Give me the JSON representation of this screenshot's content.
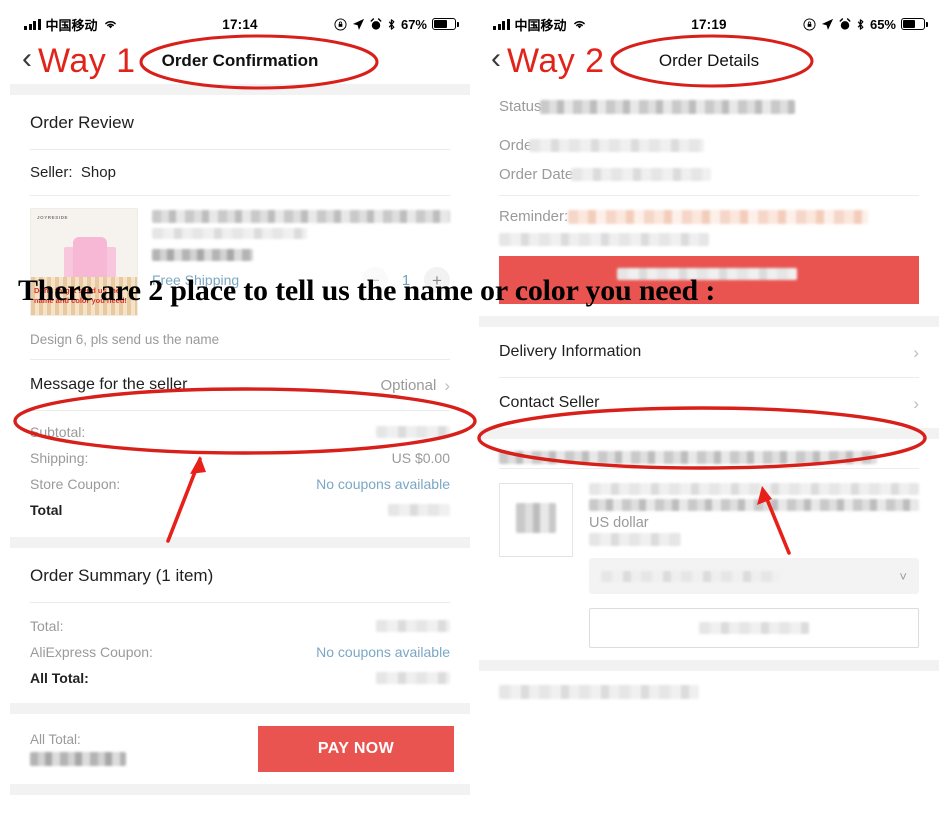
{
  "annotation": {
    "headline": "There are 2 place to tell us the name or color you need :",
    "way1": "Way 1",
    "way2": "Way 2",
    "accent_red": "#e2231a",
    "ellipse_color": "#d81f1a",
    "arrow_color": "#e8201a"
  },
  "left_panel": {
    "status_bar": {
      "carrier": "中国移动",
      "time": "17:14",
      "battery_percent": "67%",
      "icons": [
        "signal-icon",
        "wifi-icon",
        "rotation-lock-icon",
        "location-arrow-icon",
        "alarm-clock-icon",
        "bluetooth-icon",
        "battery-icon"
      ]
    },
    "nav": {
      "back_glyph": "‹",
      "title": "Order Confirmation"
    },
    "order_review": {
      "title": "Order Review",
      "seller_label": "Seller:",
      "seller_name": "Shop",
      "thumbnail": {
        "brand": "JOYRESIDE",
        "caption": "Don't forget send us the name and color you need!"
      },
      "free_shipping": "Free Shipping",
      "quantity": "1",
      "minus_glyph": "−",
      "plus_glyph": "+",
      "design_note": "Design 6, pls send us the name",
      "message_row": {
        "label": "Message for the seller",
        "value": "Optional",
        "chevron": "›"
      },
      "totals": [
        {
          "label": "Subtotal:",
          "value": "",
          "blurred": true,
          "link": false
        },
        {
          "label": "Shipping:",
          "value": "US $0.00",
          "blurred": false,
          "link": false
        },
        {
          "label": "Store Coupon:",
          "value": "No coupons available",
          "blurred": false,
          "link": true
        },
        {
          "label": "Total",
          "value": "",
          "blurred": true,
          "link": false
        }
      ]
    },
    "order_summary": {
      "title": "Order Summary (1 item)",
      "rows": [
        {
          "label": "Total:",
          "value": "",
          "blurred": true,
          "link": false
        },
        {
          "label": "AliExpress Coupon:",
          "value": "No coupons available",
          "blurred": false,
          "link": true
        },
        {
          "label": "All Total:",
          "value": "",
          "blurred": true,
          "link": false
        }
      ]
    },
    "pay_bar": {
      "all_total_label": "All Total:",
      "pay_button": "PAY NOW"
    }
  },
  "right_panel": {
    "status_bar": {
      "carrier": "中国移动",
      "time": "17:19",
      "battery_percent": "65%",
      "icons": [
        "signal-icon",
        "wifi-icon",
        "rotation-lock-icon",
        "location-arrow-icon",
        "alarm-clock-icon",
        "bluetooth-icon",
        "battery-icon"
      ]
    },
    "nav": {
      "back_glyph": "‹",
      "title": "Order Details"
    },
    "details": [
      {
        "label": "Status:",
        "blurred": true
      },
      {
        "label": "Order",
        "blurred": true
      },
      {
        "label": "Order Date:",
        "blurred": true
      },
      {
        "label": "Reminder:",
        "blurred": true
      }
    ],
    "menu_rows": [
      {
        "label": "Delivery Information",
        "chevron": "›"
      },
      {
        "label": "Contact Seller",
        "chevron": "›"
      }
    ],
    "product": {
      "currency_note": "US dollar"
    }
  }
}
